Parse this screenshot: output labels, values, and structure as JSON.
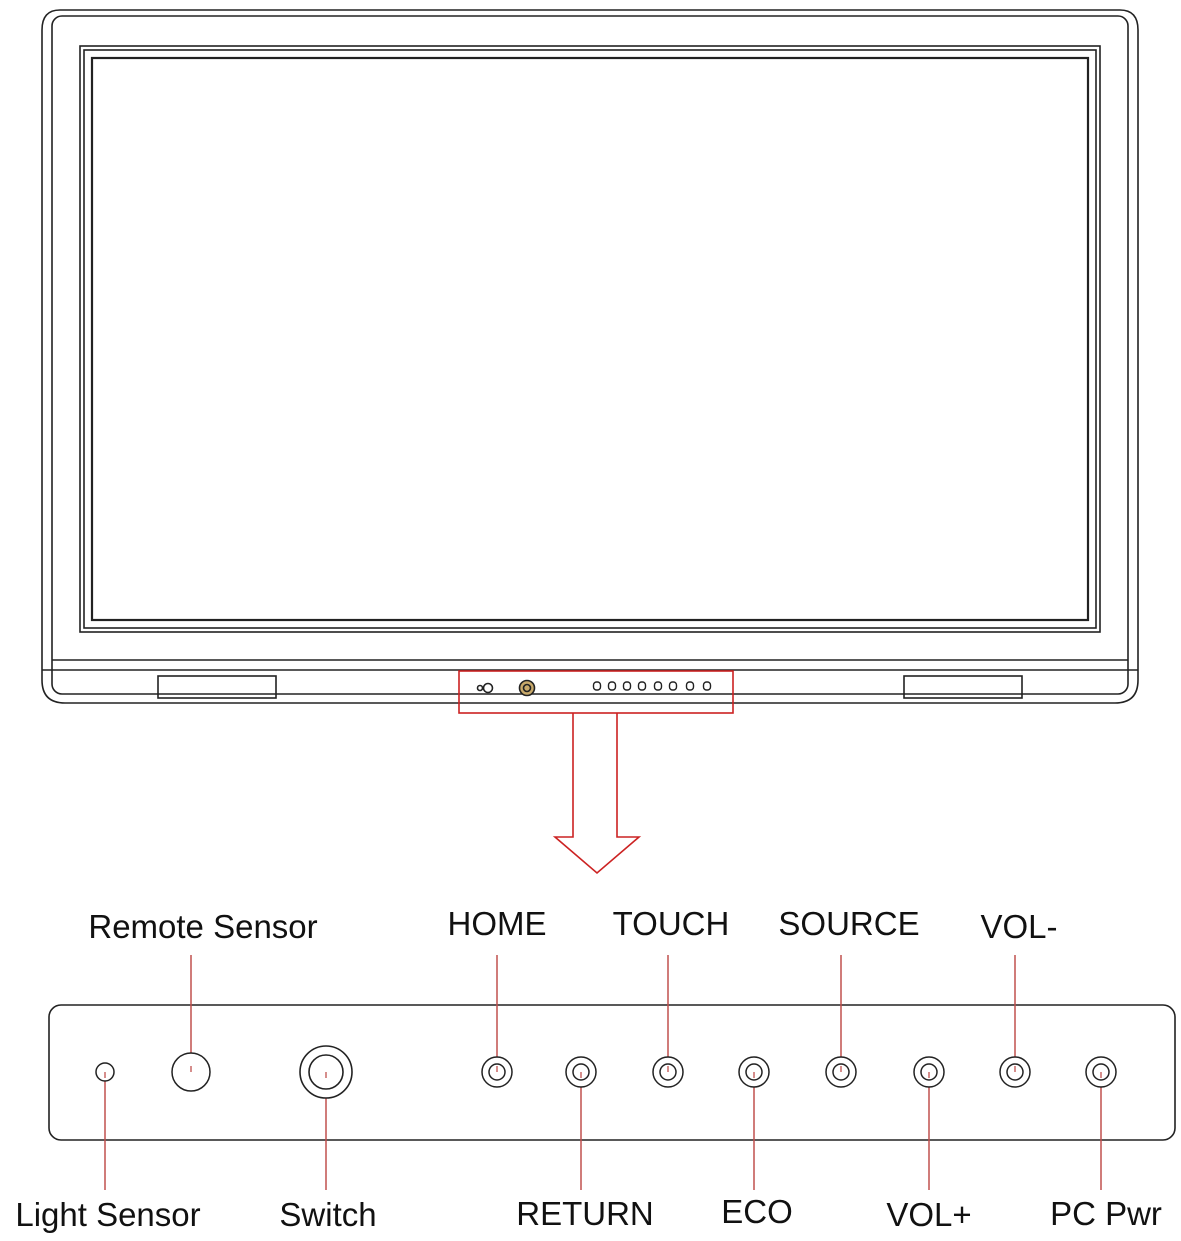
{
  "diagram": {
    "colors": {
      "line": "#222222",
      "callout": "#cc2222",
      "leader": "#c0504d",
      "switch_fill": "#c8a96a"
    },
    "panel_controls": [
      {
        "key": "light_sensor",
        "label": "Light Sensor",
        "shape": "small-circle-icon",
        "label_side": "bottom"
      },
      {
        "key": "remote_sensor",
        "label": "Remote Sensor",
        "shape": "large-circle-icon",
        "label_side": "top"
      },
      {
        "key": "switch",
        "label": "Switch",
        "shape": "double-ring-icon",
        "label_side": "bottom"
      },
      {
        "key": "home",
        "label": "HOME",
        "shape": "ring-button-icon",
        "label_side": "top"
      },
      {
        "key": "return",
        "label": "RETURN",
        "shape": "ring-button-icon",
        "label_side": "bottom"
      },
      {
        "key": "touch",
        "label": "TOUCH",
        "shape": "ring-button-icon",
        "label_side": "top"
      },
      {
        "key": "eco",
        "label": "ECO",
        "shape": "ring-button-icon",
        "label_side": "bottom"
      },
      {
        "key": "source",
        "label": "SOURCE",
        "shape": "ring-button-icon",
        "label_side": "top"
      },
      {
        "key": "vol_plus",
        "label": "VOL+",
        "shape": "ring-button-icon",
        "label_side": "bottom"
      },
      {
        "key": "vol_minus",
        "label": "VOL-",
        "shape": "ring-button-icon",
        "label_side": "top"
      },
      {
        "key": "pc_pwr",
        "label": "PC Pwr",
        "shape": "ring-button-icon",
        "label_side": "bottom"
      }
    ]
  }
}
